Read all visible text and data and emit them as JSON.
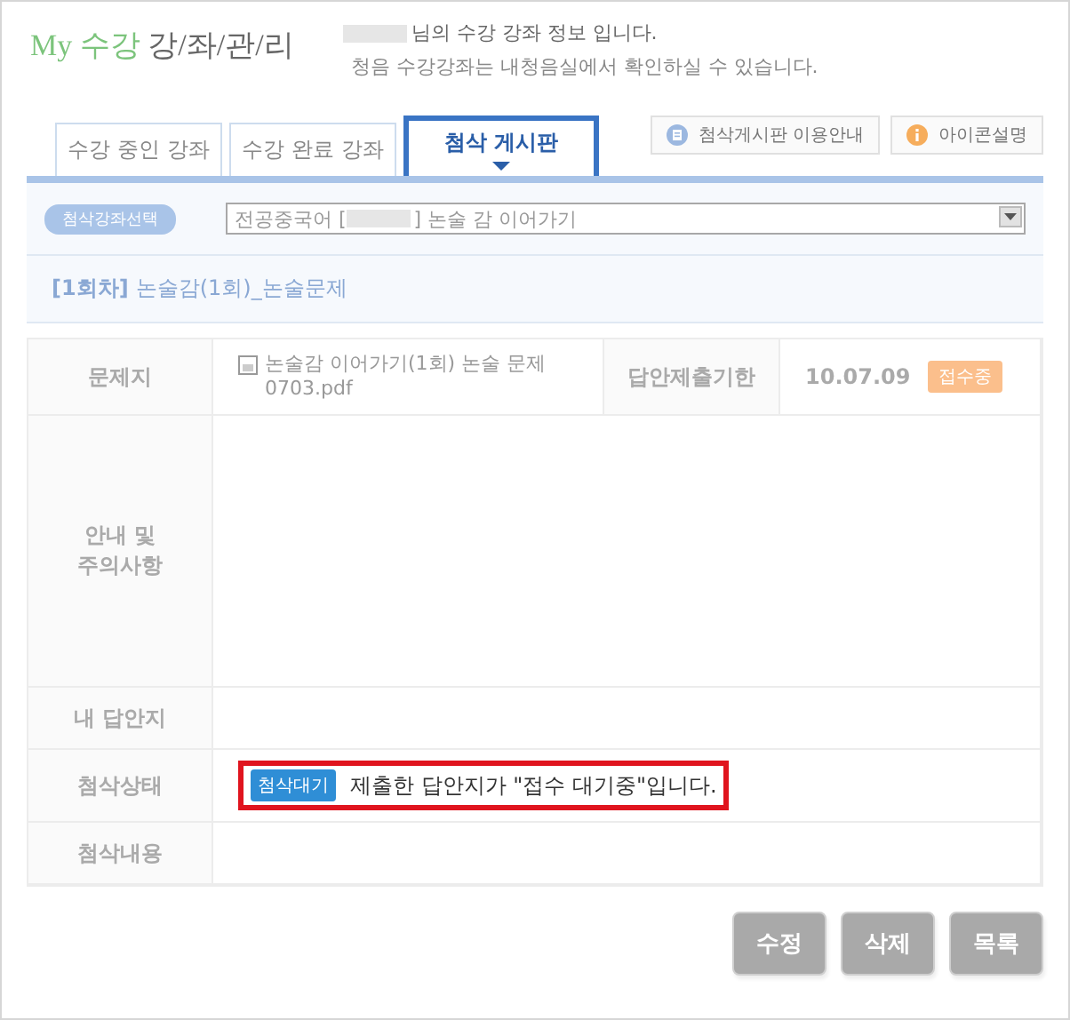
{
  "header": {
    "brand_accent": "My 수강",
    "brand_main": "강/좌/관/리",
    "greeting": "님의 수강 강좌 정보 입니다.",
    "note": "청음 수강강좌는 내청음실에서 확인하실 수 있습니다."
  },
  "tabs": [
    {
      "label": "수강 중인 강좌",
      "selected": false
    },
    {
      "label": "수강 완료 강좌",
      "selected": false
    },
    {
      "label": "첨삭 게시판",
      "selected": true
    }
  ],
  "tool_buttons": [
    {
      "label": "첨삭게시판 이용안내",
      "kind": "guide"
    },
    {
      "label": "아이콘설명",
      "kind": "info"
    }
  ],
  "course_select": {
    "label": "첨삭강좌선택",
    "value_before": "전공중국어 [",
    "value_after": "] 논술 감 이어가기"
  },
  "session": {
    "round": "[1회차]",
    "title": "논술감(1회)_논술문제"
  },
  "problem_row": {
    "label": "문제지",
    "file": "논술감 이어가기(1회) 논술 문제 0703.pdf",
    "deadline_label": "답안제출기한",
    "deadline": "10.07.09",
    "status": "접수중"
  },
  "rows": [
    {
      "kind": "tall",
      "label": "안내 및\n주의사항"
    },
    {
      "kind": "plain",
      "label": "내 답안지"
    },
    {
      "kind": "status",
      "label": "첨삭상태",
      "badge": "첨삭대기",
      "text": "제출한 답안지가 \"접수 대기중\"입니다.",
      "highlighted": true
    },
    {
      "kind": "plain",
      "label": "첨삭내용"
    }
  ],
  "buttons": [
    "수정",
    "삭제",
    "목록"
  ]
}
